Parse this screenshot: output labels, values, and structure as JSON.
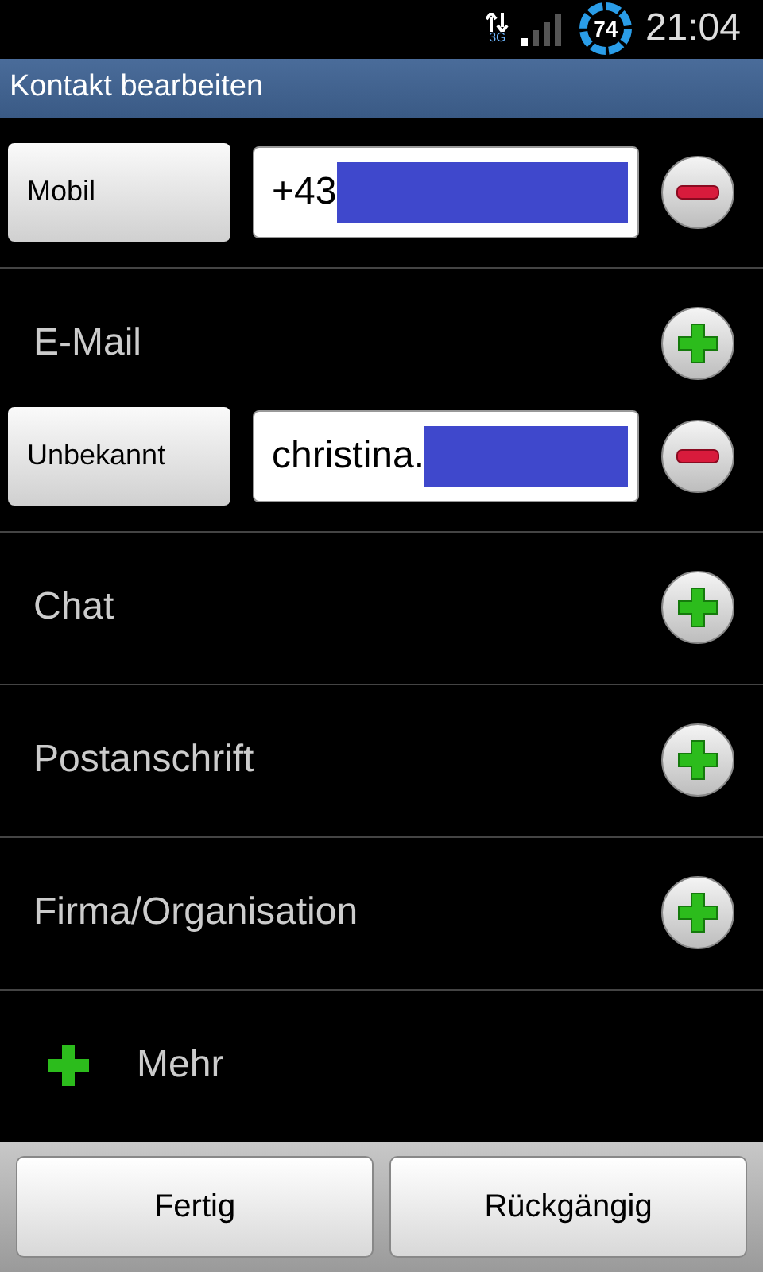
{
  "status_bar": {
    "network": "3G",
    "battery": "74",
    "time": "21:04"
  },
  "title": "Kontakt bearbeiten",
  "sections": [
    {
      "kind": "fields",
      "fields": [
        {
          "type_label": "Mobil",
          "value": "+43"
        }
      ]
    },
    {
      "kind": "group",
      "label": "E-Mail",
      "fields": [
        {
          "type_label": "Unbekannt",
          "value": "christina."
        }
      ]
    },
    {
      "kind": "group",
      "label": "Chat"
    },
    {
      "kind": "group",
      "label": "Postanschrift"
    },
    {
      "kind": "group",
      "label": "Firma/Organisation"
    }
  ],
  "more": {
    "label": "Mehr"
  },
  "buttons": [
    "Fertig",
    "Rückgängig"
  ]
}
